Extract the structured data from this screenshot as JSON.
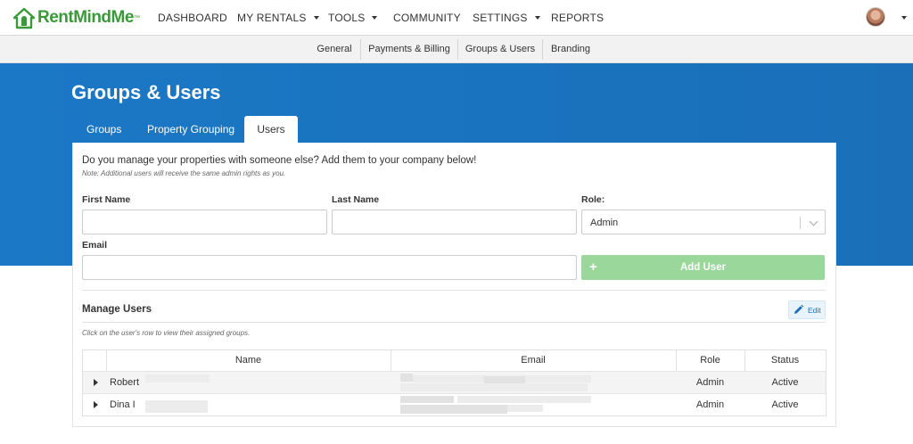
{
  "brand": {
    "name_part1": "RentMind",
    "name_part2": "Me",
    "trademark": "™",
    "color": "#3a9a3a"
  },
  "topnav": {
    "items": [
      {
        "label": "DASHBOARD",
        "has_caret": false
      },
      {
        "label": "MY RENTALS",
        "has_caret": true
      },
      {
        "label": "TOOLS",
        "has_caret": true
      },
      {
        "label": "COMMUNITY",
        "has_caret": false
      },
      {
        "label": "SETTINGS",
        "has_caret": true
      },
      {
        "label": "REPORTS",
        "has_caret": false
      }
    ]
  },
  "subnav": {
    "items": [
      {
        "label": "General"
      },
      {
        "label": "Payments & Billing"
      },
      {
        "label": "Groups & Users",
        "active": true
      },
      {
        "label": "Branding"
      }
    ]
  },
  "page": {
    "title": "Groups & Users",
    "banner_color": "#1a6fb8"
  },
  "tabs": [
    {
      "label": "Groups"
    },
    {
      "label": "Property Grouping"
    },
    {
      "label": "Users",
      "active": true
    }
  ],
  "form": {
    "intro": "Do you manage your properties with someone else? Add them to your company below!",
    "note": "Note: Additional users will receive the same admin rights as you.",
    "first_name_label": "First Name",
    "first_name_value": "",
    "last_name_label": "Last Name",
    "last_name_value": "",
    "role_label": "Role:",
    "role_value": "Admin",
    "email_label": "Email",
    "email_value": "",
    "add_button_icon": "+",
    "add_button_label": "Add User",
    "add_button_color": "#9ad79a"
  },
  "manage": {
    "title": "Manage Users",
    "edit_label": "Edit",
    "hint": "Click on the user's row to view their assigned groups."
  },
  "table": {
    "columns": [
      "Name",
      "Email",
      "Role",
      "Status"
    ],
    "rows": [
      {
        "name": "Robert",
        "role": "Admin",
        "status": "Active"
      },
      {
        "name": "Dina I",
        "role": "Admin",
        "status": "Active"
      }
    ]
  }
}
